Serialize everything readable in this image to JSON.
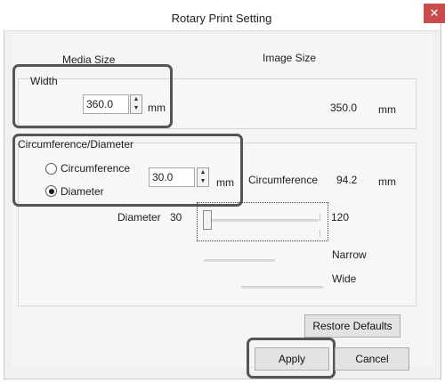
{
  "window": {
    "title": "Rotary Print Setting",
    "close_glyph": "✕"
  },
  "media_size": {
    "heading": "Media Size",
    "width_group": {
      "label": "Width",
      "value": "360.0",
      "unit": "mm"
    },
    "circ_group": {
      "label": "Circumference/Diameter",
      "options": [
        {
          "label": "Circumference",
          "selected": false
        },
        {
          "label": "Diameter",
          "selected": true
        }
      ],
      "value": "30.0",
      "unit": "mm"
    }
  },
  "image_size": {
    "heading": "Image Size",
    "width_value": "350.0",
    "width_unit": "mm",
    "circumference_label": "Circumference",
    "circumference_value": "94.2",
    "circumference_unit": "mm"
  },
  "diameter_slider": {
    "label": "Diameter",
    "min": "30",
    "max": "120",
    "level": 0.0
  },
  "narrow_label": "Narrow",
  "wide_label": "Wide",
  "buttons": {
    "restore": "Restore Defaults",
    "apply": "Apply",
    "cancel": "Cancel"
  },
  "colors": {
    "highlight": "#555555",
    "close_bg": "#c94b4b"
  }
}
